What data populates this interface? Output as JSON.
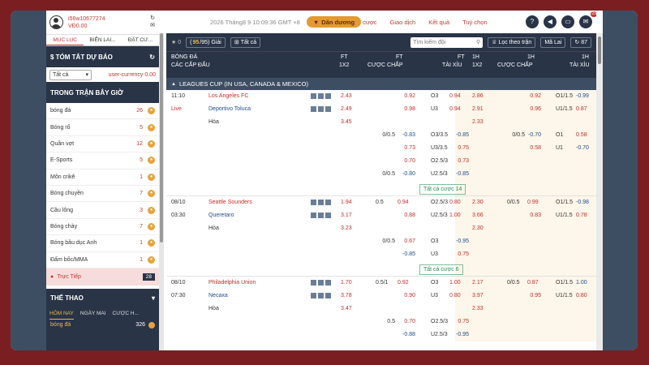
{
  "user": {
    "id": "i56w10677274",
    "balance": "VĐ0.00"
  },
  "sidebar_tabs": [
    "MỤC LỤC",
    "BIỂN LAI...",
    "ĐẶT CƯ..."
  ],
  "summary": {
    "title": "$ TÓM TẮT DỰ BÁO",
    "select": "Tất cả",
    "currency": "user-currency 0.00"
  },
  "in_play_title": "TRONG TRẬN BÂY GIỜ",
  "sports": [
    {
      "name": "bóng đá",
      "count": "26"
    },
    {
      "name": "Bóng rổ",
      "count": "5"
    },
    {
      "name": "Quần vợt",
      "count": "12"
    },
    {
      "name": "E-Sports",
      "count": "5"
    },
    {
      "name": "Môn crikê",
      "count": "1"
    },
    {
      "name": "Bóng chuyền",
      "count": "7"
    },
    {
      "name": "Cầu lông",
      "count": "3"
    },
    {
      "name": "Bóng chày",
      "count": "7"
    },
    {
      "name": "Bóng bầu dục Anh",
      "count": "1"
    },
    {
      "name": "Đấm bốc/MMA",
      "count": "1"
    }
  ],
  "live": {
    "label": "Trực Tiếp",
    "count": "28"
  },
  "sports_section": {
    "title": "THỂ THAO",
    "tabs": [
      "HÔM NAY",
      "NGÀY MAI",
      "CƯỢC H..."
    ],
    "row": {
      "name": "bóng đá",
      "count": "326"
    }
  },
  "topnav": {
    "clock": "2026 Tháng8 9 10:09:36 GMT +8",
    "deposit": "Dân dương",
    "links": [
      "cược",
      "Giao dịch",
      "Kết quả",
      "Tuỳ chọn"
    ],
    "badge": "25"
  },
  "toolbar": {
    "star_count": "0",
    "count_shown": "95",
    "count_total": "95",
    "giai": "Giải",
    "all": "Tất cả",
    "search_placeholder": "Tìm kiếm đội",
    "filter": "Lọc theo trận",
    "refresh": "Mã Lai",
    "tickets": "87"
  },
  "headers": {
    "sport": "BÓNG ĐÁ",
    "levels": "CÁC CẤP ĐẤU",
    "ft": "FT",
    "ht": "1H",
    "x12": "1X2",
    "handicap": "CƯỢC CHẤP",
    "ou": "TÀI XỈU"
  },
  "league": "LEAGUES CUP (IN USA, CANADA & MEXICO)",
  "matches": [
    {
      "date": "11:10",
      "time": "Live",
      "home": "Los Angeles FC",
      "away": "Deportivo Toluca",
      "draw": "Hòa",
      "ft1x2": [
        "2.43",
        "2.49",
        "3.45"
      ],
      "fth": [
        "0.92",
        "0.98"
      ],
      "fto": [
        "O3",
        "0.94",
        "U3",
        "0.94"
      ],
      "ht1x2": [
        "2.86",
        "2.91",
        "2.33"
      ],
      "hth": [
        "0.92",
        "0.96"
      ],
      "hto": [
        "O1/1.5",
        "-0.99",
        "U1/1.5",
        "0.87"
      ],
      "extra": [
        {
          "fth_line": "0/0.5",
          "fth": "-0.83",
          "fto_line": "O3/3.5",
          "fto": "-0.85",
          "hth_line": "0/0.5",
          "hth": "-0.70",
          "hto_line": "O1",
          "hto": "0.58"
        },
        {
          "fth_line": "",
          "fth": "0.73",
          "fto_line": "U3/3.5",
          "fto": "0.75",
          "hth_line": "",
          "hth": "0.58",
          "hto_line": "U1",
          "hto": "-0.70"
        },
        {
          "fth_line": "",
          "fth": "0.70",
          "fto_line": "O2.5/3",
          "fto": "0.73",
          "hth_line": "",
          "hth": "",
          "hto_line": "",
          "hto": ""
        },
        {
          "fth_line": "0/0.5",
          "fth": "-0.80",
          "fto_line": "U2.5/3",
          "fto": "-0.85",
          "hth_line": "",
          "hth": "",
          "hto_line": "",
          "hto": ""
        }
      ],
      "more": "Tất cả cược 14"
    },
    {
      "date": "08/10",
      "time": "03:30",
      "home": "Seattle Sounders",
      "away": "Queretaro",
      "draw": "Hòa",
      "ft1x2": [
        "1.94",
        "3.17",
        "3.23"
      ],
      "fth": [
        "0.5",
        "0.94",
        "",
        "0.88"
      ],
      "fto": [
        "O2.5/3",
        "0.80",
        "U2.5/3",
        "1.00"
      ],
      "ht1x2": [
        "2.30",
        "3.66",
        "2.30"
      ],
      "hth": [
        "0/0.5",
        "0.99",
        "",
        "0.83"
      ],
      "hto": [
        "O1/1.5",
        "-0.98",
        "U1/1.5",
        "0.78"
      ],
      "extra": [
        {
          "fth_line": "0/0.5",
          "fth": "0.67",
          "fto_line": "O3",
          "fto": "-0.95"
        },
        {
          "fth_line": "",
          "fth": "-0.85",
          "fto_line": "U3",
          "fto": "0.75"
        }
      ],
      "more": "Tất cả cược 6"
    },
    {
      "date": "08/10",
      "time": "07:30",
      "home": "Philadelphia Union",
      "away": "Necaxa",
      "draw": "Hòa",
      "ft1x2": [
        "1.70",
        "3.78",
        "3.47"
      ],
      "fth": [
        "0.5/1",
        "0.92",
        "",
        "0.90"
      ],
      "fto": [
        "O3",
        "1.00",
        "U3",
        "0.80"
      ],
      "ht1x2": [
        "2.17",
        "3.97",
        "2.33"
      ],
      "hth": [
        "0/0.5",
        "0.87",
        "",
        "0.95"
      ],
      "hto": [
        "O1/1.5",
        "1.00",
        "U1/1.5",
        "0.80"
      ],
      "extra": [
        {
          "fth_line": "0.5",
          "fth": "0.70",
          "fto_line": "O2.5/3",
          "fto": "0.75"
        },
        {
          "fth_line": "",
          "fth": "-0.88",
          "fto_line": "U2.5/3",
          "fto": "-0.95"
        }
      ]
    }
  ]
}
